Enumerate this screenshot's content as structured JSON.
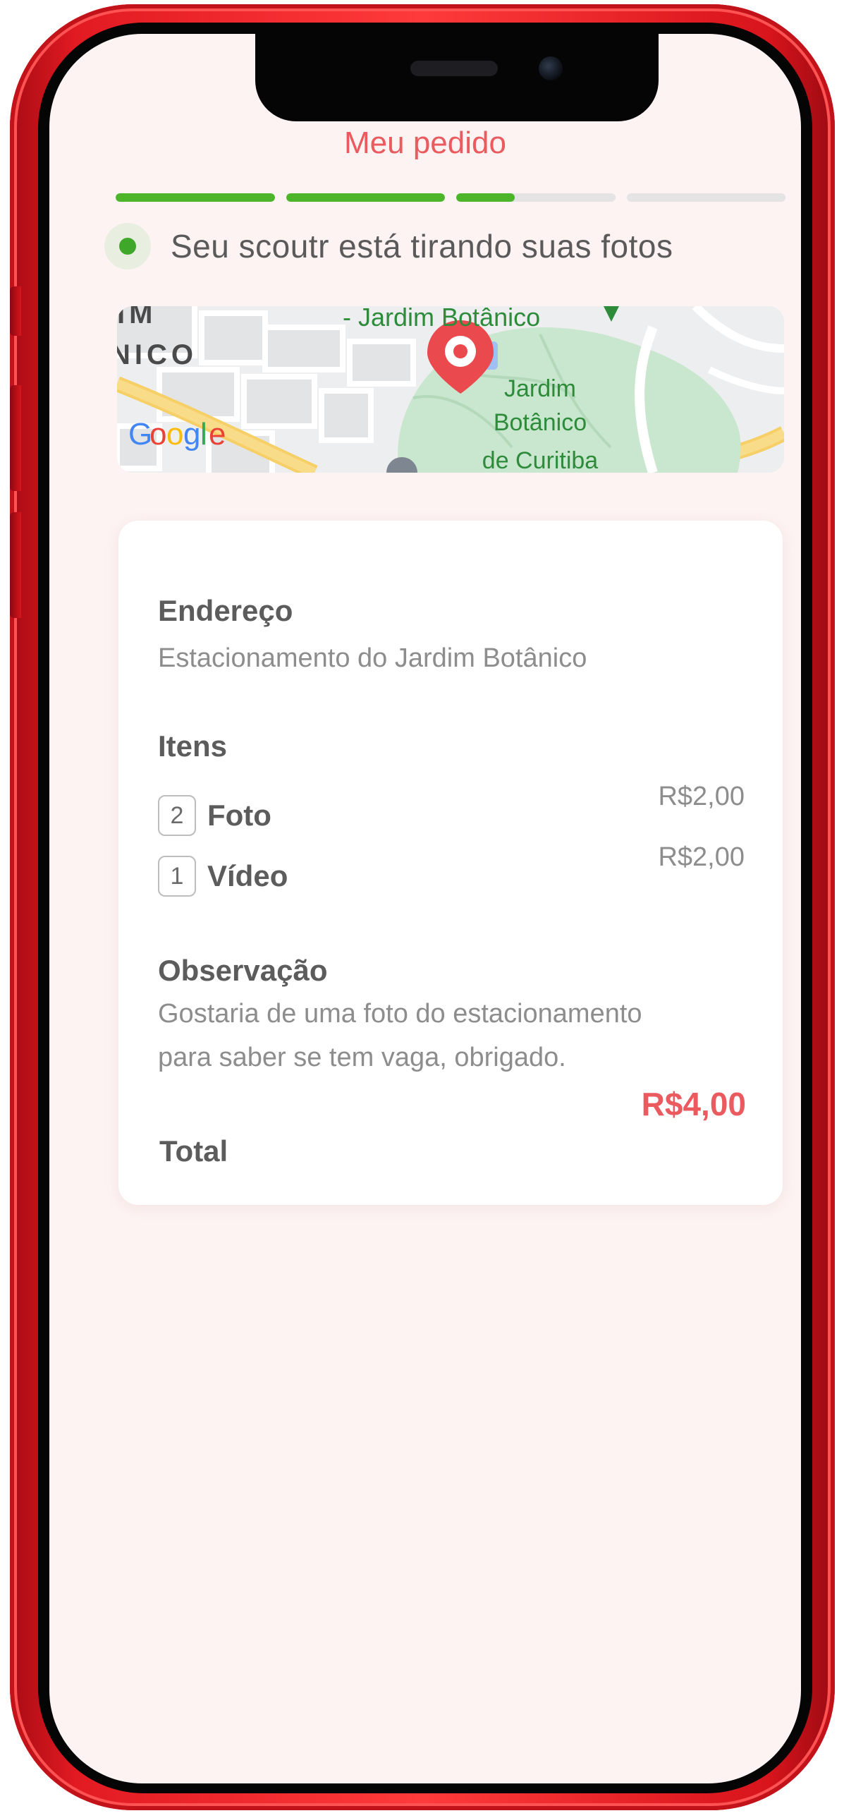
{
  "header": {
    "title": "Meu pedido"
  },
  "progress": {
    "segments": [
      1,
      1,
      0.37
    ]
  },
  "status": {
    "text": "Seu scoutr está tirando suas fotos"
  },
  "map": {
    "place_label": "- Jardim Botânico",
    "park_label_line1": "Jardim",
    "park_label_line2": "Botânico",
    "park_label_line3": "de Curitiba",
    "edge_label_1": "IM",
    "edge_label_2": "NICO",
    "logo": "Google"
  },
  "order": {
    "address_label": "Endereço",
    "address_value": "Estacionamento do Jardim Botânico",
    "items_label": "Itens",
    "items": [
      {
        "qty": "2",
        "name": "Foto",
        "price": "R$2,00"
      },
      {
        "qty": "1",
        "name": "Vídeo",
        "price": "R$2,00"
      }
    ],
    "note_label": "Observação",
    "note_line1": "Gostaria de uma foto do estacionamento",
    "note_line2": "para saber se tem vaga, obrigado.",
    "total_label": "Total",
    "total_value": "R$4,00"
  },
  "colors": {
    "accent": "#ea5a5e",
    "progress_fill": "#4cb52a",
    "status_dot": "#3fa82a",
    "phone_frame": "#e21a22"
  }
}
